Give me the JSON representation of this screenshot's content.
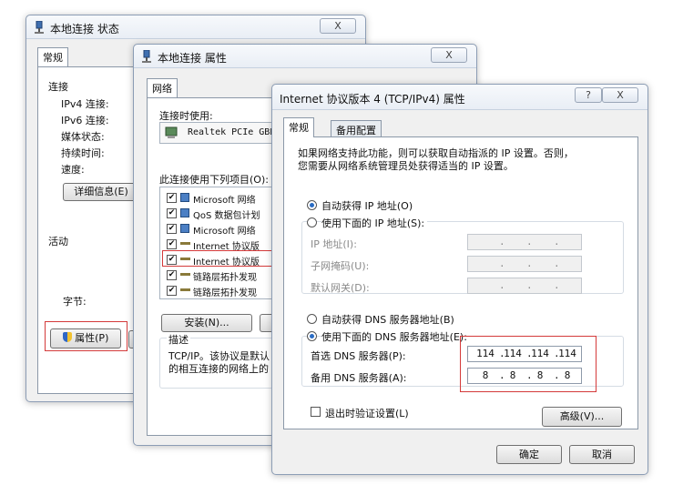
{
  "status_window": {
    "title": "本地连接 状态",
    "close_glyph": "X",
    "tab": "常规",
    "section_connection": "连接",
    "fields": [
      "IPv4 连接:",
      "IPv6 连接:",
      "媒体状态:",
      "持续时间:",
      "速度:"
    ],
    "details_button": "详细信息(E)",
    "section_activity": "活动",
    "bytes_label": "字节:",
    "properties_button": "属性(P)"
  },
  "props_window": {
    "title": "本地连接 属性",
    "close_glyph": "X",
    "tab": "网络",
    "connect_using_label": "连接时使用:",
    "adapter": "Realtek PCIe GBE",
    "items_label": "此连接使用下列项目(O):",
    "items": [
      {
        "label": "Microsoft 网络",
        "checked": true,
        "icon": "network-client-icon"
      },
      {
        "label": "QoS 数据包计划",
        "checked": true,
        "icon": "qos-icon"
      },
      {
        "label": "Microsoft 网络",
        "checked": true,
        "icon": "file-sharing-icon"
      },
      {
        "label": "Internet 协议版",
        "checked": true,
        "icon": "protocol-icon"
      },
      {
        "label": "Internet 协议版",
        "checked": true,
        "icon": "protocol-icon"
      },
      {
        "label": "链路层拓扑发现",
        "checked": true,
        "icon": "protocol-icon"
      },
      {
        "label": "链路层拓扑发现",
        "checked": true,
        "icon": "protocol-icon"
      }
    ],
    "install_button": "安装(N)...",
    "description_label": "描述",
    "description_line1": "TCP/IP。该协议是默认",
    "description_line2": "的相互连接的网络上的"
  },
  "ipv4_window": {
    "title": "Internet 协议版本 4 (TCP/IPv4) 属性",
    "help_glyph": "?",
    "close_glyph": "X",
    "tabs": [
      "常规",
      "备用配置"
    ],
    "intro_line1": "如果网络支持此功能，则可以获取自动指派的 IP 设置。否则，",
    "intro_line2": "您需要从网络系统管理员处获得适当的 IP 设置。",
    "auto_ip_label": "自动获得 IP 地址(O)",
    "manual_ip_label": "使用下面的 IP 地址(S):",
    "ip_address_label": "IP 地址(I):",
    "subnet_label": "子网掩码(U):",
    "gateway_label": "默认网关(D):",
    "auto_dns_label": "自动获得 DNS 服务器地址(B)",
    "manual_dns_label": "使用下面的 DNS 服务器地址(E):",
    "preferred_dns_label": "首选 DNS 服务器(P):",
    "preferred_dns": [
      "114",
      "114",
      "114",
      "114"
    ],
    "alternate_dns_label": "备用 DNS 服务器(A):",
    "alternate_dns": [
      "8",
      "8",
      "8",
      "8"
    ],
    "validate_label": "退出时验证设置(L)",
    "advanced_button": "高级(V)...",
    "ok_button": "确定",
    "cancel_button": "取消",
    "selected_ip_mode": "auto",
    "selected_dns_mode": "manual"
  },
  "colors": {
    "highlight_box": "#d43a3a",
    "radio_dot": "#2a6cc4"
  }
}
